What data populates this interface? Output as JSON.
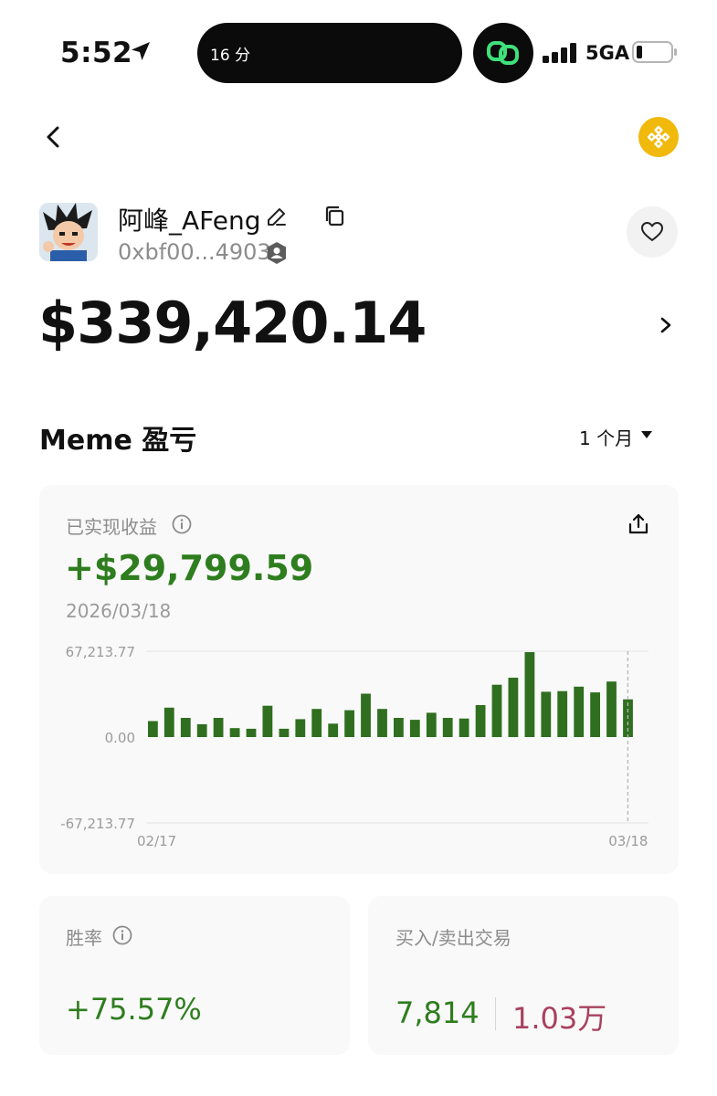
{
  "status_bar": {
    "time": "5:52",
    "island_text": "16 分",
    "network": "5GA"
  },
  "profile": {
    "name": "阿峰_AFeng",
    "address": "0xbf00...4903"
  },
  "balance": "$339,420.14",
  "section": {
    "title": "Meme 盈亏",
    "period": "1 个月"
  },
  "pnl": {
    "label": "已实现收益",
    "value": "+$29,799.59",
    "date": "2026/03/18"
  },
  "chart_data": {
    "type": "bar",
    "y_tick_labels": [
      "67,213.77",
      "0.00",
      "-67,213.77"
    ],
    "ylim": [
      -67213.77,
      67213.77
    ],
    "x_start_label": "02/17",
    "x_end_label": "03/18",
    "values": [
      12500,
      23000,
      15000,
      10000,
      15000,
      7000,
      6500,
      24500,
      6500,
      14000,
      22000,
      10500,
      21000,
      34000,
      22000,
      15000,
      13500,
      19000,
      15000,
      14500,
      25000,
      41000,
      46500,
      66500,
      35500,
      36000,
      39500,
      35000,
      43500,
      29500
    ],
    "bar_color": "#2f6f1f"
  },
  "stats": {
    "win_rate_label": "胜率",
    "win_rate": "+75.57%",
    "trades_label": "买入/卖出交易",
    "buys": "7,814",
    "sells": "1.03万"
  },
  "icons": {
    "back": "chevron-left-icon",
    "chain": "bnb-chain-icon",
    "favorite": "heart-outline-icon",
    "share": "share-upload-icon"
  }
}
